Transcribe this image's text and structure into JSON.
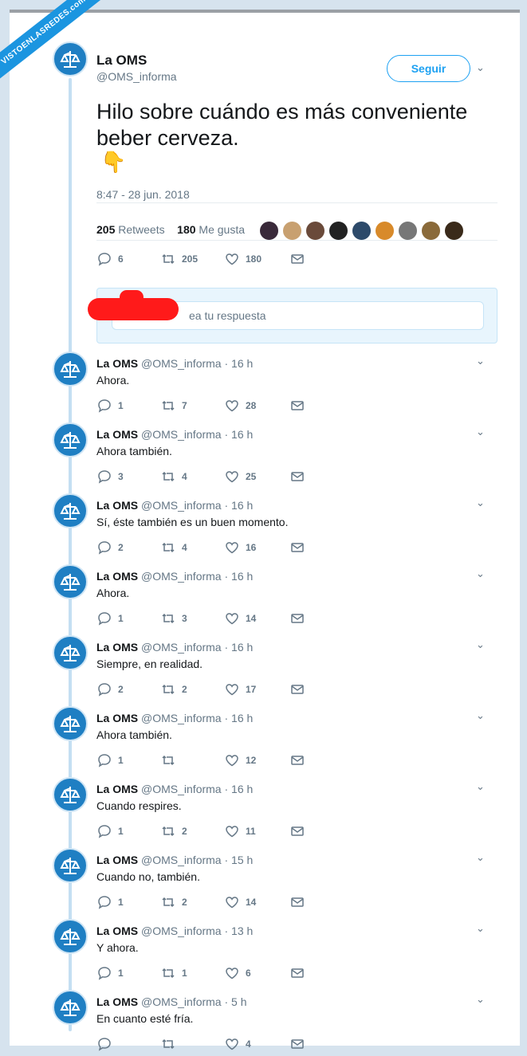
{
  "watermark": "VISTOENLASREDES.com",
  "main": {
    "name": "La OMS",
    "handle": "@OMS_informa",
    "follow_label": "Seguir",
    "text": "Hilo sobre cuándo es más conveniente beber cerveza.",
    "emoji": "👇",
    "date": "8:47 - 28 jun. 2018",
    "retweets_count": "205",
    "retweets_label": "Retweets",
    "likes_count": "180",
    "likes_label": "Me gusta",
    "actions": {
      "reply": "6",
      "retweet": "205",
      "like": "180"
    },
    "reply_placeholder": "ea tu respuesta"
  },
  "replies": [
    {
      "name": "La OMS",
      "handle": "@OMS_informa · 16 h",
      "text": "Ahora.",
      "reply": "1",
      "retweet": "7",
      "like": "28"
    },
    {
      "name": "La OMS",
      "handle": "@OMS_informa · 16 h",
      "text": "Ahora también.",
      "reply": "3",
      "retweet": "4",
      "like": "25"
    },
    {
      "name": "La OMS",
      "handle": "@OMS_informa · 16 h",
      "text": "Sí, éste también es un buen momento.",
      "reply": "2",
      "retweet": "4",
      "like": "16"
    },
    {
      "name": "La OMS",
      "handle": "@OMS_informa · 16 h",
      "text": "Ahora.",
      "reply": "1",
      "retweet": "3",
      "like": "14"
    },
    {
      "name": "La OMS",
      "handle": "@OMS_informa · 16 h",
      "text": "Siempre, en realidad.",
      "reply": "2",
      "retweet": "2",
      "like": "17"
    },
    {
      "name": "La OMS",
      "handle": "@OMS_informa · 16 h",
      "text": "Ahora también.",
      "reply": "1",
      "retweet": "",
      "like": "12"
    },
    {
      "name": "La OMS",
      "handle": "@OMS_informa · 16 h",
      "text": "Cuando respires.",
      "reply": "1",
      "retweet": "2",
      "like": "11"
    },
    {
      "name": "La OMS",
      "handle": "@OMS_informa · 15 h",
      "text": "Cuando no, también.",
      "reply": "1",
      "retweet": "2",
      "like": "14"
    },
    {
      "name": "La OMS",
      "handle": "@OMS_informa · 13 h",
      "text": "Y ahora.",
      "reply": "1",
      "retweet": "1",
      "like": "6"
    },
    {
      "name": "La OMS",
      "handle": "@OMS_informa · 5 h",
      "text": "En cuanto esté fría.",
      "reply": "",
      "retweet": "",
      "like": "4"
    }
  ],
  "colors": {
    "accent": "#1da1f2",
    "avatar": "#1f7fc3",
    "thread_line": "#c4dff2",
    "redaction": "#ff1a1a"
  },
  "likers": [
    "#3a2a3a",
    "#c8a070",
    "#6a4a3a",
    "#222222",
    "#2d4a6a",
    "#d88a2a",
    "#777777",
    "#8a6a3a",
    "#3a2a1a"
  ]
}
